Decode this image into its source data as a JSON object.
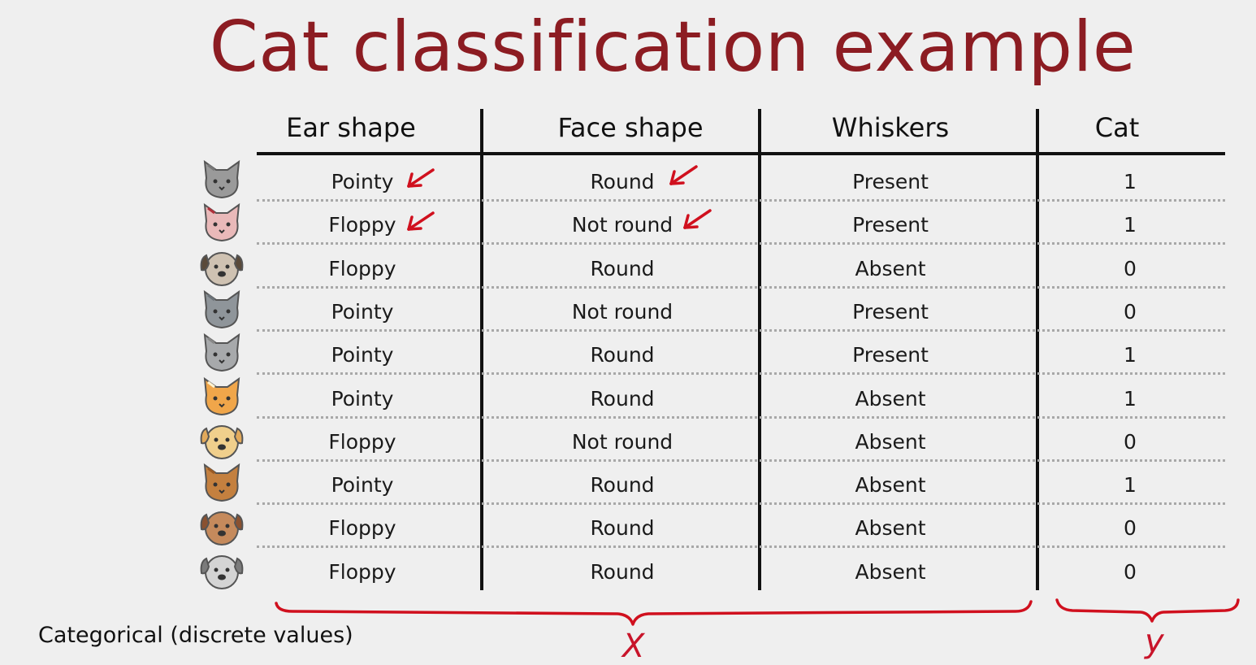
{
  "title": "Cat classification example",
  "columns": [
    "Ear shape",
    "Face shape",
    "Whiskers",
    "Cat"
  ],
  "rows": [
    {
      "animal": "gray-cat-icon",
      "ear": "Pointy",
      "face": "Round",
      "whiskers": "Present",
      "cat": "1"
    },
    {
      "animal": "pink-cat-icon",
      "ear": "Floppy",
      "face": "Not round",
      "whiskers": "Present",
      "cat": "1"
    },
    {
      "animal": "pug-dog-icon",
      "ear": "Floppy",
      "face": "Round",
      "whiskers": "Absent",
      "cat": "0"
    },
    {
      "animal": "wolf-dog-icon",
      "ear": "Pointy",
      "face": "Not round",
      "whiskers": "Present",
      "cat": "0"
    },
    {
      "animal": "gray-tabby-cat-icon",
      "ear": "Pointy",
      "face": "Round",
      "whiskers": "Present",
      "cat": "1"
    },
    {
      "animal": "orange-cat-icon",
      "ear": "Pointy",
      "face": "Round",
      "whiskers": "Absent",
      "cat": "1"
    },
    {
      "animal": "golden-dog-icon",
      "ear": "Floppy",
      "face": "Not round",
      "whiskers": "Absent",
      "cat": "0"
    },
    {
      "animal": "brown-cat-icon",
      "ear": "Pointy",
      "face": "Round",
      "whiskers": "Absent",
      "cat": "1"
    },
    {
      "animal": "brown-dog-icon",
      "ear": "Floppy",
      "face": "Round",
      "whiskers": "Absent",
      "cat": "0"
    },
    {
      "animal": "gray-dog-icon",
      "ear": "Floppy",
      "face": "Round",
      "whiskers": "Absent",
      "cat": "0"
    }
  ],
  "footnote": "Categorical (discrete values)",
  "brace_labels": {
    "features": "X",
    "target": "y"
  },
  "colors": {
    "title": "#8c1c22",
    "annotation": "#d0101e",
    "background": "#efefef"
  }
}
